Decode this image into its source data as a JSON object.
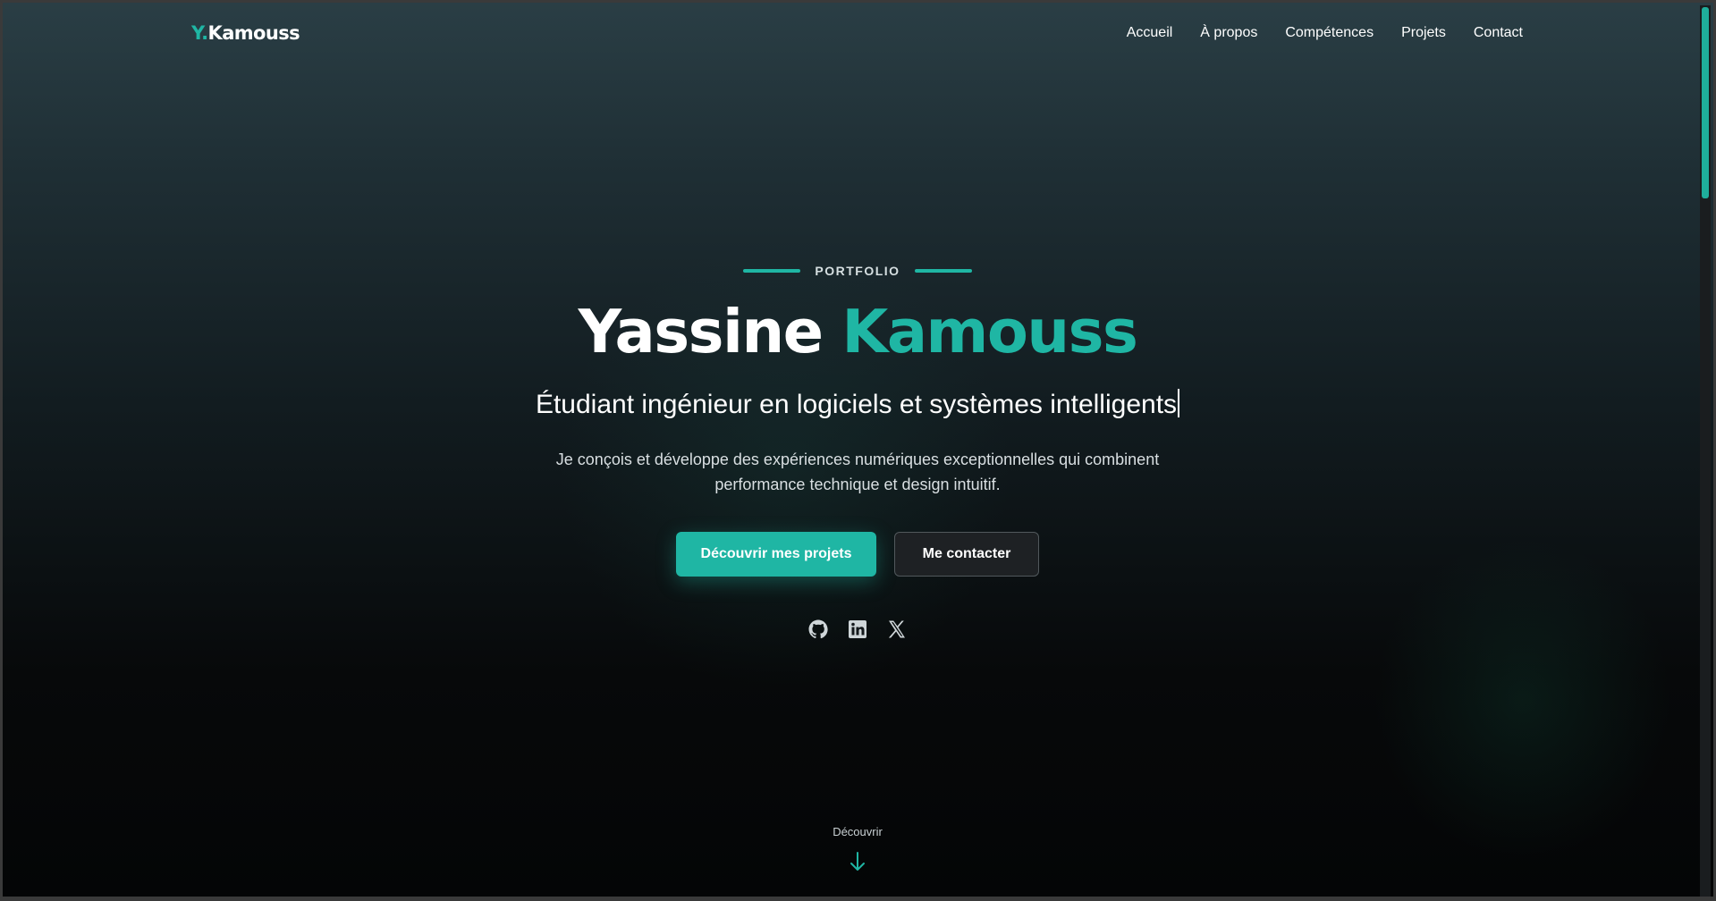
{
  "nav": {
    "logo_prefix": "Y.",
    "logo_name": "Kamouss",
    "links": [
      "Accueil",
      "À propos",
      "Compétences",
      "Projets",
      "Contact"
    ]
  },
  "hero": {
    "eyebrow": "PORTFOLIO",
    "first_name": "Yassine",
    "last_name": "Kamouss",
    "subtitle": "Étudiant ingénieur en logiciels et systèmes intelligents",
    "description_line1": "Je conçois et développe des expériences numériques exceptionnelles qui combinent",
    "description_line2": "performance technique et design intuitif.",
    "primary_button": "Découvrir mes projets",
    "secondary_button": "Me contacter",
    "socials": [
      {
        "icon": "github-icon"
      },
      {
        "icon": "linkedin-icon"
      },
      {
        "icon": "x-icon"
      }
    ],
    "scroll_label": "Découvrir"
  },
  "colors": {
    "accent": "#1fb6a4",
    "background": "#0b0f11"
  }
}
